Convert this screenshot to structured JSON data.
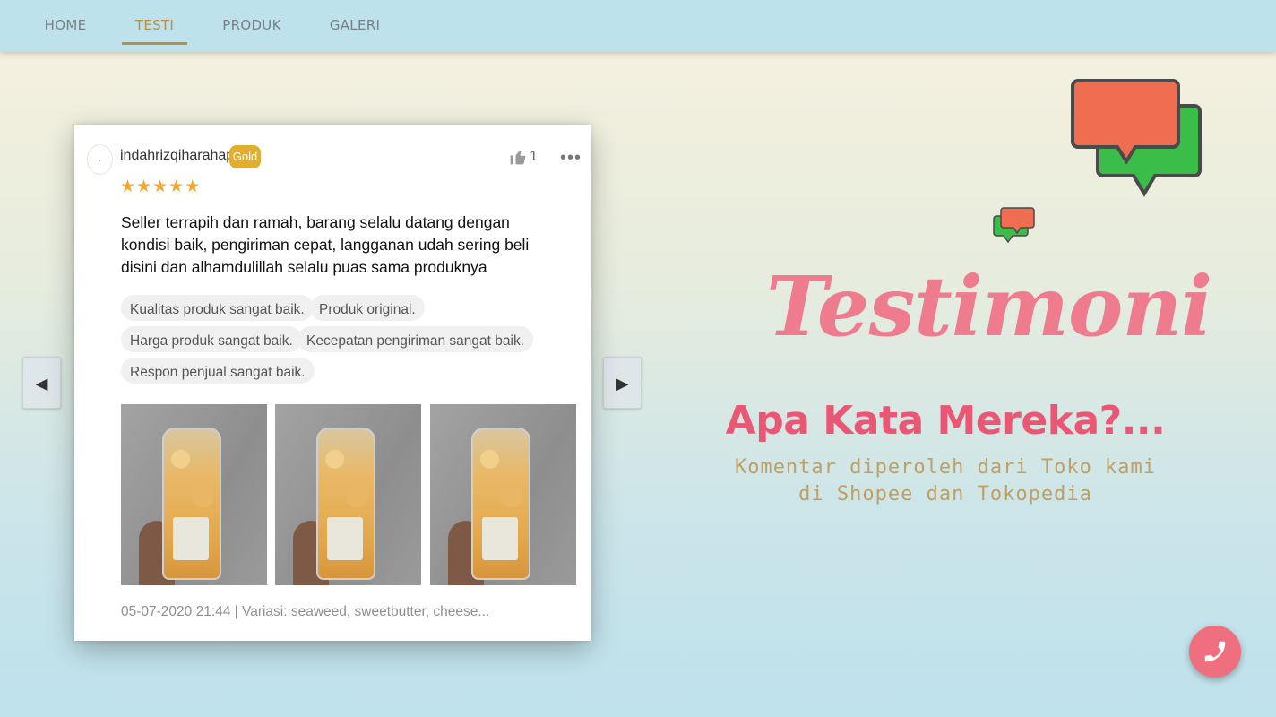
{
  "nav": {
    "items": [
      {
        "label": "HOME"
      },
      {
        "label": "TESTI"
      },
      {
        "label": "PRODUK"
      },
      {
        "label": "GALERI"
      }
    ],
    "active": "TESTI"
  },
  "review": {
    "username": "indahrizqiharahap",
    "badge": "Gold",
    "likes": "1",
    "rating": 5,
    "text": "Seller terrapih dan ramah, barang selalu datang dengan kondisi baik, pengiriman cepat, langganan udah sering beli disini dan alhamdulillah selalu puas sama produknya",
    "tags": [
      "Kualitas produk sangat baik.",
      "Produk original.",
      "Harga produk sangat baik.",
      "Kecepatan pengiriman sangat baik.",
      "Respon penjual sangat baik."
    ],
    "meta": "05-07-2020 21:44 | Variasi: seaweed, sweetbutter, cheese..."
  },
  "hero": {
    "script_title": "Testimoni",
    "heading": "Apa Kata Mereka?...",
    "subtitle_line1": "Komentar diperoleh dari Toko kami",
    "subtitle_line2": "di Shopee dan Tokopedia"
  },
  "icons": {
    "prev": "caret-left-icon",
    "next": "caret-right-icon",
    "chat": "chat-bubbles-icon",
    "call": "phone-icon",
    "like": "thumbs-up-icon",
    "more": "more-dots-icon"
  },
  "colors": {
    "accent_gold": "#b98e45",
    "script_pink": "#ef7b8f",
    "heading_pink": "#e95775",
    "subtitle_tan": "#bf9f63",
    "call_button": "#ef6f7e",
    "badge_gold": "#e3ae2d"
  }
}
